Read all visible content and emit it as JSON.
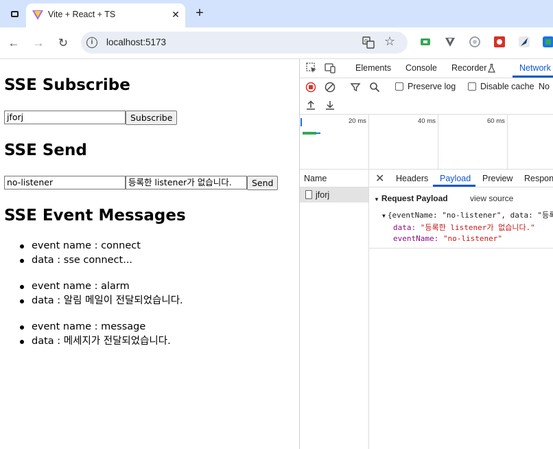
{
  "browser": {
    "tab": {
      "title": "Vite + React + TS"
    },
    "address": {
      "url": "localhost:5173"
    }
  },
  "page": {
    "subscribe": {
      "heading": "SSE Subscribe",
      "input_value": "jforj",
      "button_label": "Subscribe"
    },
    "send": {
      "heading": "SSE Send",
      "name_value": "no-listener",
      "message_value": "등록한 listener가 없습니다.",
      "button_label": "Send"
    },
    "events": {
      "heading": "SSE Event Messages",
      "items": [
        {
          "name_line": "event name : connect",
          "data_line": "data : sse connect..."
        },
        {
          "name_line": "event name : alarm",
          "data_line": "data : 알림 메일이 전달되었습니다."
        },
        {
          "name_line": "event name : message",
          "data_line": "data : 메세지가 전달되었습니다."
        }
      ]
    }
  },
  "devtools": {
    "tabs": [
      "Elements",
      "Console",
      "Recorder",
      "Network"
    ],
    "active_tab": "Network",
    "preserve_log": {
      "label": "Preserve log",
      "checked": false
    },
    "disable_cache": {
      "label": "Disable cache",
      "checked": false
    },
    "throttle": "No",
    "timeline_labels": [
      "20 ms",
      "40 ms",
      "60 ms"
    ],
    "request_list": {
      "header": "Name",
      "requests": [
        "jforj"
      ]
    },
    "detail_tabs": [
      "Headers",
      "Payload",
      "Preview",
      "Respons"
    ],
    "active_detail_tab": "Payload",
    "payload": {
      "title": "Request Payload",
      "view_source": "view source",
      "object_preview": "{eventName: \"no-listener\", data: \"등록한",
      "data_key": "data:",
      "data_value": "\"등록한 listener가 없습니다.\"",
      "eventName_key": "eventName:",
      "eventName_value": "\"no-listener\""
    }
  }
}
